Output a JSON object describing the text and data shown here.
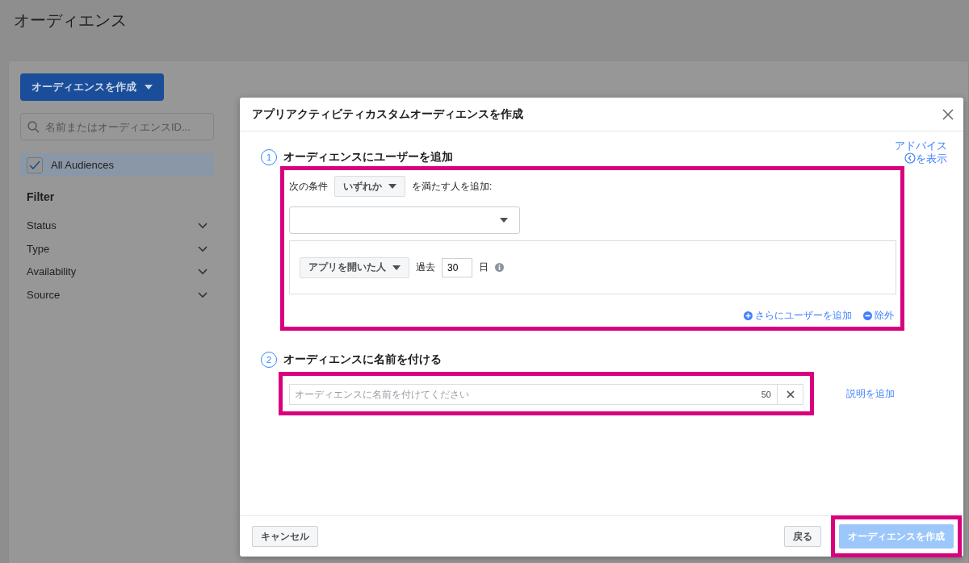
{
  "page": {
    "title": "オーディエンス",
    "create_button": "オーディエンスを作成",
    "search": {
      "placeholder": "名前またはオーディエンスID..."
    },
    "all_audiences": {
      "label": "All Audiences",
      "checked": true
    },
    "filter": {
      "heading": "Filter",
      "items": [
        {
          "label": "Status",
          "expanded": false
        },
        {
          "label": "Type",
          "expanded": false
        },
        {
          "label": "Availability",
          "expanded": false
        },
        {
          "label": "Source",
          "expanded": false
        }
      ]
    }
  },
  "dialog": {
    "title": "アプリアクティビティカスタムオーディエンスを作成",
    "advice_link": {
      "line1": "アドバイス",
      "line2": "を表示"
    },
    "step1": {
      "number": "1",
      "heading": "オーディエンスにユーザーを追加",
      "condition_prefix": "次の条件",
      "match_dropdown": "いずれか",
      "condition_suffix": "を満たす人を追加:",
      "rule": {
        "event_dropdown": "アプリを開いた人",
        "past_label": "過去",
        "days": "30",
        "days_unit": "日"
      },
      "add_more_link": "さらにユーザーを追加",
      "exclude_link": "除外"
    },
    "step2": {
      "number": "2",
      "heading": "オーディエンスに名前を付ける",
      "name_field": {
        "placeholder": "オーディエンスに名前を付けてください",
        "char_count": "50"
      },
      "add_description_link": "説明を追加"
    },
    "footer": {
      "cancel": "キャンセル",
      "back": "戻る",
      "create": {
        "label": "オーディエンスを作成",
        "disabled": true
      }
    }
  }
}
